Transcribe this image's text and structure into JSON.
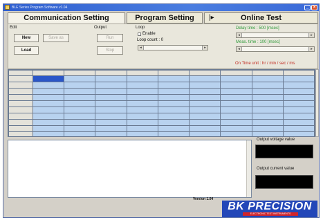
{
  "window": {
    "title": "BLE Series Program Software v1.04",
    "accent": "#3b6ad8"
  },
  "tabs": [
    {
      "label": "Communication Setting",
      "active": true
    },
    {
      "label": "Program Setting",
      "active": false
    },
    {
      "label": "Online Test",
      "active": false,
      "icon": "play-step-icon"
    }
  ],
  "edit": {
    "heading": "Edit",
    "new_label": "New",
    "saveas_label": "Save as",
    "load_label": "Load"
  },
  "output": {
    "heading": "Output",
    "run_label": "Run",
    "stop_label": "Stop"
  },
  "loop": {
    "heading": "Loop",
    "enable_label": "Enable",
    "count_label": "Loop count : 0"
  },
  "timing": {
    "delay_label": "Delay time : 500 [msec]",
    "meas_label": "Meas. time : 100 [msec]",
    "unit_label": "On Time unit : hr / min / sec / ms"
  },
  "readouts": {
    "voltage_label": "Output voltage value",
    "current_label": "Output current value"
  },
  "footer": {
    "version": "Version 1.04",
    "logo_text": "BK PRECISION",
    "logo_sub": "ELECTRONIC TEST INSTRUMENTS"
  },
  "colors": {
    "grid_fill": "#b8d2ef",
    "selection": "#2a56c8",
    "logo_blue": "#2347b8",
    "logo_red": "#d2242a",
    "green_text": "#2e9a3a",
    "red_text": "#c0281e"
  }
}
